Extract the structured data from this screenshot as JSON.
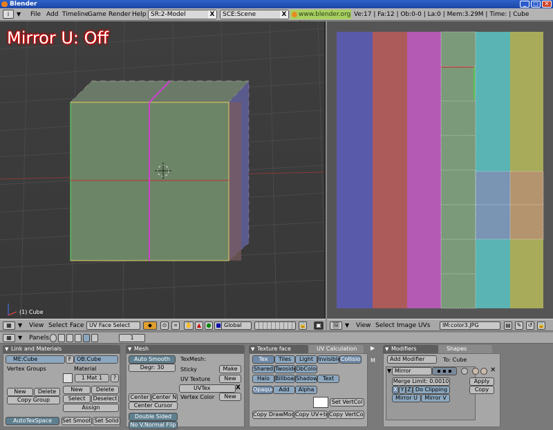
{
  "window": {
    "title": "Blender",
    "minimize": "_",
    "maximize": "□",
    "close": "✕"
  },
  "infobar": {
    "menus": [
      "File",
      "Add",
      "Timeline",
      "Game",
      "Render",
      "Help"
    ],
    "screen": "SR:2-Model",
    "scene": "SCE:Scene",
    "url": "www.blender.org 244",
    "stats": "Ve:17 | Fa:12 | Ob:0-0 | La:0  | Mem:3.29M | Time: | Cube"
  },
  "viewport": {
    "overlay": "Mirror U: Off",
    "object_label": "(1) Cube"
  },
  "view3d_header": {
    "menus": [
      "View",
      "Select",
      "Face"
    ],
    "mode": "UV Face Select",
    "orientation": "Global"
  },
  "uv_header": {
    "menus": [
      "View",
      "Select",
      "Image",
      "UVs"
    ],
    "image": "IM:color3.JPG"
  },
  "buttons_header": {
    "panels_label": "Panels",
    "frame": "1"
  },
  "link_materials": {
    "tab": "Link and Materials",
    "mesh": "ME:Cube",
    "f": "F",
    "object": "OB:Cube",
    "vertex_groups": "Vertex Groups",
    "material": "Material",
    "mat_slot": "1 Mat 1",
    "question": "?",
    "new1": "New",
    "delete1": "Delete",
    "copy_group": "Copy Group",
    "new2": "New",
    "delete2": "Delete",
    "select": "Select",
    "deselect": "Deselect",
    "assign": "Assign",
    "autotexspace": "AutoTexSpace",
    "set_smooth": "Set Smooth",
    "set_solid": "Set Solid"
  },
  "mesh": {
    "tab": "Mesh",
    "auto_smooth": "Auto Smooth",
    "degr": "Degr: 30",
    "texmesh": "TexMesh:",
    "sticky": "Sticky",
    "make": "Make",
    "uv_texture": "UV Texture",
    "new_uv": "New",
    "uvtex": "UVTex",
    "vertex_color": "Vertex Color",
    "new_vc": "New",
    "center": "Center",
    "center_new": "Center New",
    "center_cursor": "Center Cursor",
    "double_sided": "Double Sided",
    "no_vnormal": "No V.Normal Flip"
  },
  "texture_face": {
    "tab": "Texture face",
    "tab2": "UV Calculation",
    "row1": [
      "Tex",
      "Tiles",
      "Light",
      "Invisible",
      "Collisio"
    ],
    "row2": [
      "Shared",
      "Twoside",
      "ObColor"
    ],
    "row3": [
      "Halo",
      "Billboar",
      "Shadow",
      "Text"
    ],
    "row4": [
      "Opaque",
      "Add",
      "Alpha"
    ],
    "set_vertcol": "Set VertCol",
    "copy_drawmode": "Copy DrawMode",
    "copy_uv": "Copy UV+te",
    "copy_vertcol": "Copy VertCol"
  },
  "modifiers": {
    "tab": "Modifiers",
    "tab2": "Shapes",
    "add_modifier": "Add Modifier",
    "to": "To: Cube",
    "name": "Mirror",
    "merge_limit": "Merge Limit: 0.0010",
    "x": "X",
    "y": "Y",
    "z": "Z",
    "do_clipping": "Do Clipping",
    "mirror_u": "Mirror U",
    "mirror_v": "Mirror V",
    "apply": "Apply",
    "copy": "Copy"
  },
  "colors": {
    "accent": "#6f8aa8",
    "uv_url": "#a8d060"
  }
}
